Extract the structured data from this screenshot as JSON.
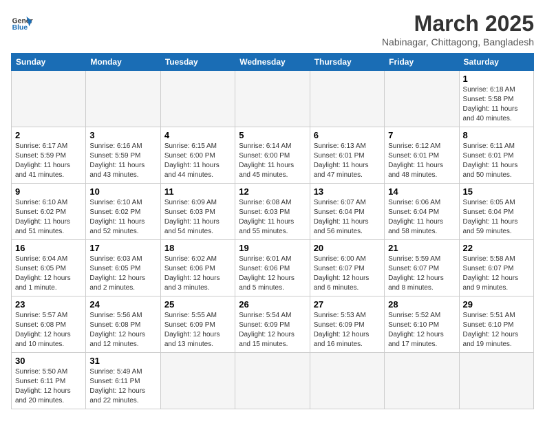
{
  "header": {
    "logo_general": "General",
    "logo_blue": "Blue",
    "month_title": "March 2025",
    "subtitle": "Nabinagar, Chittagong, Bangladesh"
  },
  "weekdays": [
    "Sunday",
    "Monday",
    "Tuesday",
    "Wednesday",
    "Thursday",
    "Friday",
    "Saturday"
  ],
  "days": [
    {
      "date": 1,
      "sunrise": "6:18 AM",
      "sunset": "5:58 PM",
      "daylight": "11 hours and 40 minutes."
    },
    {
      "date": 2,
      "sunrise": "6:17 AM",
      "sunset": "5:59 PM",
      "daylight": "11 hours and 41 minutes."
    },
    {
      "date": 3,
      "sunrise": "6:16 AM",
      "sunset": "5:59 PM",
      "daylight": "11 hours and 43 minutes."
    },
    {
      "date": 4,
      "sunrise": "6:15 AM",
      "sunset": "6:00 PM",
      "daylight": "11 hours and 44 minutes."
    },
    {
      "date": 5,
      "sunrise": "6:14 AM",
      "sunset": "6:00 PM",
      "daylight": "11 hours and 45 minutes."
    },
    {
      "date": 6,
      "sunrise": "6:13 AM",
      "sunset": "6:01 PM",
      "daylight": "11 hours and 47 minutes."
    },
    {
      "date": 7,
      "sunrise": "6:12 AM",
      "sunset": "6:01 PM",
      "daylight": "11 hours and 48 minutes."
    },
    {
      "date": 8,
      "sunrise": "6:11 AM",
      "sunset": "6:01 PM",
      "daylight": "11 hours and 50 minutes."
    },
    {
      "date": 9,
      "sunrise": "6:10 AM",
      "sunset": "6:02 PM",
      "daylight": "11 hours and 51 minutes."
    },
    {
      "date": 10,
      "sunrise": "6:10 AM",
      "sunset": "6:02 PM",
      "daylight": "11 hours and 52 minutes."
    },
    {
      "date": 11,
      "sunrise": "6:09 AM",
      "sunset": "6:03 PM",
      "daylight": "11 hours and 54 minutes."
    },
    {
      "date": 12,
      "sunrise": "6:08 AM",
      "sunset": "6:03 PM",
      "daylight": "11 hours and 55 minutes."
    },
    {
      "date": 13,
      "sunrise": "6:07 AM",
      "sunset": "6:04 PM",
      "daylight": "11 hours and 56 minutes."
    },
    {
      "date": 14,
      "sunrise": "6:06 AM",
      "sunset": "6:04 PM",
      "daylight": "11 hours and 58 minutes."
    },
    {
      "date": 15,
      "sunrise": "6:05 AM",
      "sunset": "6:04 PM",
      "daylight": "11 hours and 59 minutes."
    },
    {
      "date": 16,
      "sunrise": "6:04 AM",
      "sunset": "6:05 PM",
      "daylight": "12 hours and 1 minute."
    },
    {
      "date": 17,
      "sunrise": "6:03 AM",
      "sunset": "6:05 PM",
      "daylight": "12 hours and 2 minutes."
    },
    {
      "date": 18,
      "sunrise": "6:02 AM",
      "sunset": "6:06 PM",
      "daylight": "12 hours and 3 minutes."
    },
    {
      "date": 19,
      "sunrise": "6:01 AM",
      "sunset": "6:06 PM",
      "daylight": "12 hours and 5 minutes."
    },
    {
      "date": 20,
      "sunrise": "6:00 AM",
      "sunset": "6:07 PM",
      "daylight": "12 hours and 6 minutes."
    },
    {
      "date": 21,
      "sunrise": "5:59 AM",
      "sunset": "6:07 PM",
      "daylight": "12 hours and 8 minutes."
    },
    {
      "date": 22,
      "sunrise": "5:58 AM",
      "sunset": "6:07 PM",
      "daylight": "12 hours and 9 minutes."
    },
    {
      "date": 23,
      "sunrise": "5:57 AM",
      "sunset": "6:08 PM",
      "daylight": "12 hours and 10 minutes."
    },
    {
      "date": 24,
      "sunrise": "5:56 AM",
      "sunset": "6:08 PM",
      "daylight": "12 hours and 12 minutes."
    },
    {
      "date": 25,
      "sunrise": "5:55 AM",
      "sunset": "6:09 PM",
      "daylight": "12 hours and 13 minutes."
    },
    {
      "date": 26,
      "sunrise": "5:54 AM",
      "sunset": "6:09 PM",
      "daylight": "12 hours and 15 minutes."
    },
    {
      "date": 27,
      "sunrise": "5:53 AM",
      "sunset": "6:09 PM",
      "daylight": "12 hours and 16 minutes."
    },
    {
      "date": 28,
      "sunrise": "5:52 AM",
      "sunset": "6:10 PM",
      "daylight": "12 hours and 17 minutes."
    },
    {
      "date": 29,
      "sunrise": "5:51 AM",
      "sunset": "6:10 PM",
      "daylight": "12 hours and 19 minutes."
    },
    {
      "date": 30,
      "sunrise": "5:50 AM",
      "sunset": "6:11 PM",
      "daylight": "12 hours and 20 minutes."
    },
    {
      "date": 31,
      "sunrise": "5:49 AM",
      "sunset": "6:11 PM",
      "daylight": "12 hours and 22 minutes."
    }
  ]
}
